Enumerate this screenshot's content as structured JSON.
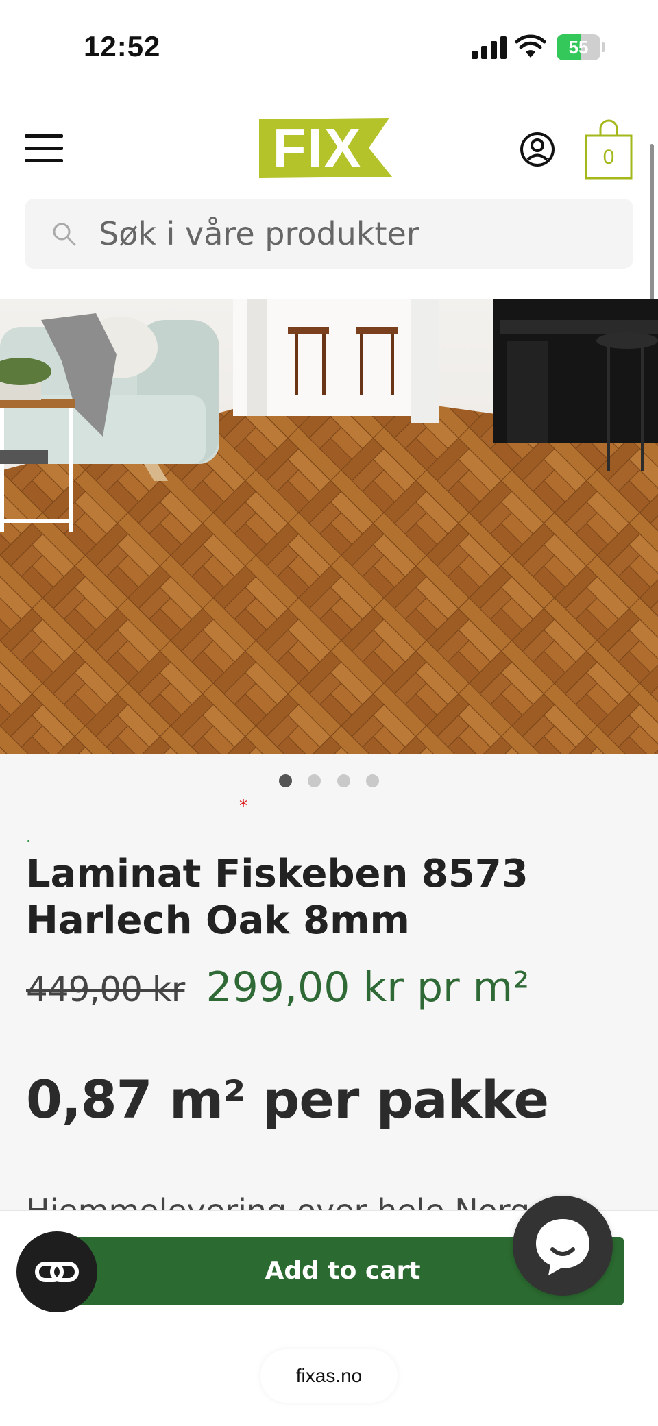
{
  "status_bar": {
    "time": "12:52",
    "battery_level": "55",
    "battery_percent": 55,
    "icons": [
      "cellular-signal-icon",
      "wifi-icon",
      "battery-charging-icon"
    ]
  },
  "header": {
    "logo_text": "FIX",
    "cart_count": "0",
    "icons": [
      "hamburger-menu-icon",
      "account-icon",
      "shopping-bag-icon"
    ]
  },
  "search": {
    "placeholder": "Søk i våre produkter"
  },
  "gallery": {
    "image_count": 4,
    "active_index": 0,
    "subject": "herringbone-laminate-floor-photo"
  },
  "product": {
    "required_marker": "*",
    "title": "Laminat Fiskeben 8573 Harlech Oak 8mm",
    "price_old": "449,00 kr",
    "price_new": "299,00 kr pr m²",
    "pack_size": "0,87 m² per pakke",
    "delivery_text": "Hjemmelevering over hele Norge"
  },
  "actions": {
    "add_to_cart_label": "Add to cart"
  },
  "browser": {
    "url": "fixas.no"
  },
  "colors": {
    "brand_lime": "#b5c32a",
    "price_green": "#2f6a36",
    "cart_button_green": "#2b6a30",
    "strike_red": "#d11111"
  }
}
